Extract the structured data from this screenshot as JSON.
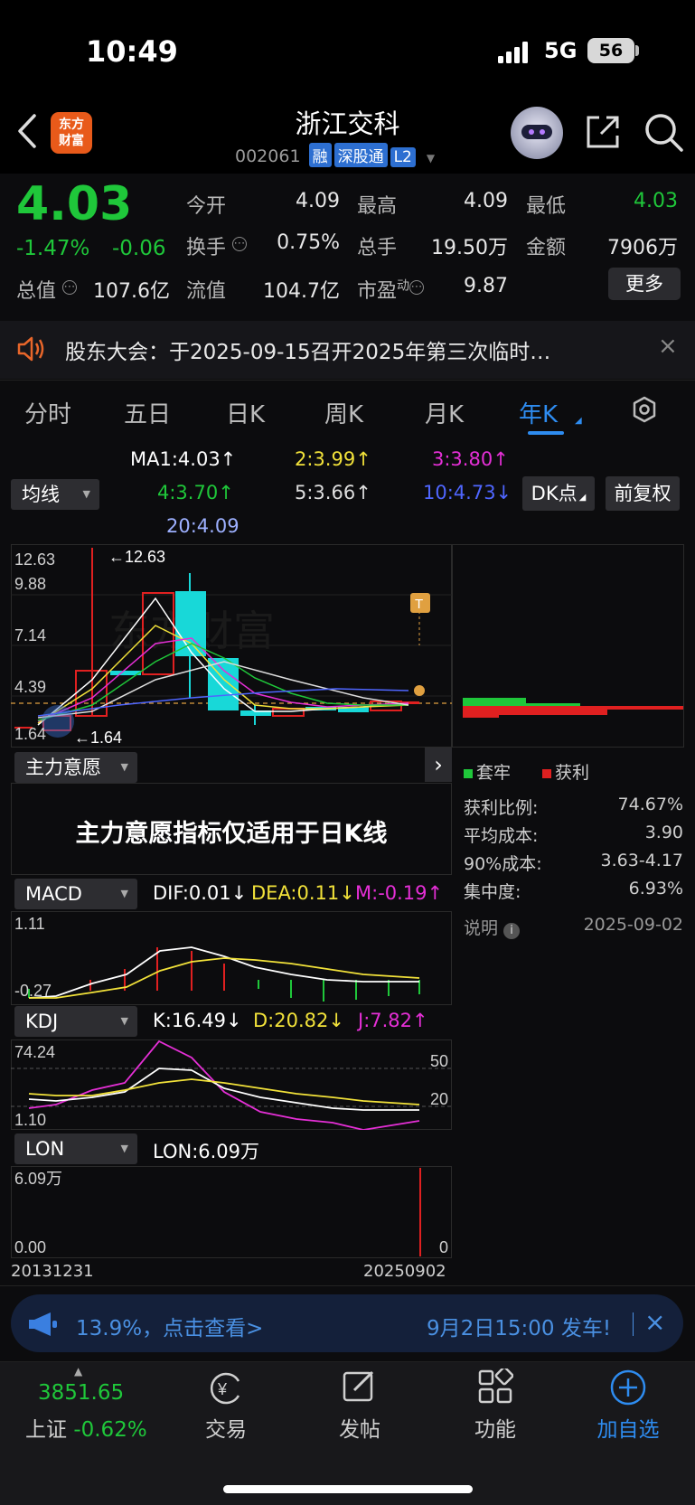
{
  "status": {
    "time": "10:49",
    "network": "5G",
    "battery": "56"
  },
  "header": {
    "logo_line1": "东方",
    "logo_line2": "财富",
    "title": "浙江交科",
    "code": "002061",
    "tags": [
      "融",
      "深股通",
      "L2"
    ]
  },
  "quote": {
    "price": "4.03",
    "change_pct": "-1.47%",
    "change_amt": "-0.06",
    "rows": [
      [
        {
          "label": "今开",
          "value": "4.09"
        },
        {
          "label": "最高",
          "value": "4.09"
        },
        {
          "label": "最低",
          "value": "4.03"
        }
      ],
      [
        {
          "label": "换手",
          "value": "0.75%"
        },
        {
          "label": "总手",
          "value": "19.50万"
        },
        {
          "label": "金额",
          "value": "7906万"
        }
      ]
    ],
    "row3": {
      "total_label": "总值",
      "total_value": "107.6亿",
      "float_label": "流值",
      "float_value": "104.7亿",
      "pe_label": "市盈",
      "pe_sup": "动",
      "pe_value": "9.87"
    },
    "more_label": "更多",
    "low_color": "#1fc73a"
  },
  "notice": {
    "text": "股东大会：于2025-09-15召开2025年第三次临时…",
    "close": "×"
  },
  "tabs": [
    {
      "label": "分时"
    },
    {
      "label": "五日"
    },
    {
      "label": "日K"
    },
    {
      "label": "周K"
    },
    {
      "label": "月K"
    },
    {
      "label": "年K"
    }
  ],
  "ma": {
    "selector": "均线",
    "ma1": "MA1:4.03↑",
    "ma2": "2:3.99↑",
    "ma3": "3:3.80↑",
    "ma4": "4:3.70↑",
    "ma5": "5:3.66↑",
    "ma10": "10:4.73↓",
    "ma20": "20:4.09",
    "dk_button": "DK点",
    "adjust_button": "前复权"
  },
  "kline": {
    "y_labels": [
      "12.63",
      "9.88",
      "7.14",
      "4.39",
      "1.64"
    ],
    "high_marker": "←12.63",
    "low_marker": "←1.64",
    "t_marker": "T",
    "watermark": "东方财富"
  },
  "chip": {
    "legend_trap": "套牢",
    "legend_profit": "获利",
    "stats": [
      {
        "label": "获利比例:",
        "value": "74.67%"
      },
      {
        "label": "平均成本:",
        "value": "3.90"
      },
      {
        "label": "90%成本:",
        "value": "3.63-4.17"
      },
      {
        "label": "集中度:",
        "value": "6.93%"
      }
    ],
    "note_label": "说明",
    "date": "2025-09-02"
  },
  "zhuli": {
    "selector": "主力意愿",
    "message": "主力意愿指标仅适用于日K线"
  },
  "macd": {
    "selector": "MACD",
    "dif": "DIF:0.01↓",
    "dea": "DEA:0.11↓",
    "m": "M:-0.19↑",
    "y_top": "1.11",
    "y_bottom": "-0.27"
  },
  "kdj": {
    "selector": "KDJ",
    "k": "K:16.49↓",
    "d": "D:20.82↓",
    "j": "J:7.82↑",
    "y_top": "74.24",
    "y_bottom": "1.10",
    "ref50": "50",
    "ref20": "20"
  },
  "lon": {
    "selector": "LON",
    "value": "LON:6.09万",
    "y_top": "6.09万",
    "y_bottom": "0.00",
    "right_zero": "0",
    "date_start": "20131231",
    "date_end": "20250902"
  },
  "banner": {
    "text1": "13.9%，点击查看>",
    "text2": "9月2日15:00 发车!",
    "close": "×"
  },
  "bottom_nav": {
    "index_value": "3851.65",
    "index_name": "上证",
    "index_change": "-0.62%",
    "items": [
      {
        "label": "交易"
      },
      {
        "label": "发帖"
      },
      {
        "label": "功能"
      },
      {
        "label": "加自选"
      }
    ]
  }
}
